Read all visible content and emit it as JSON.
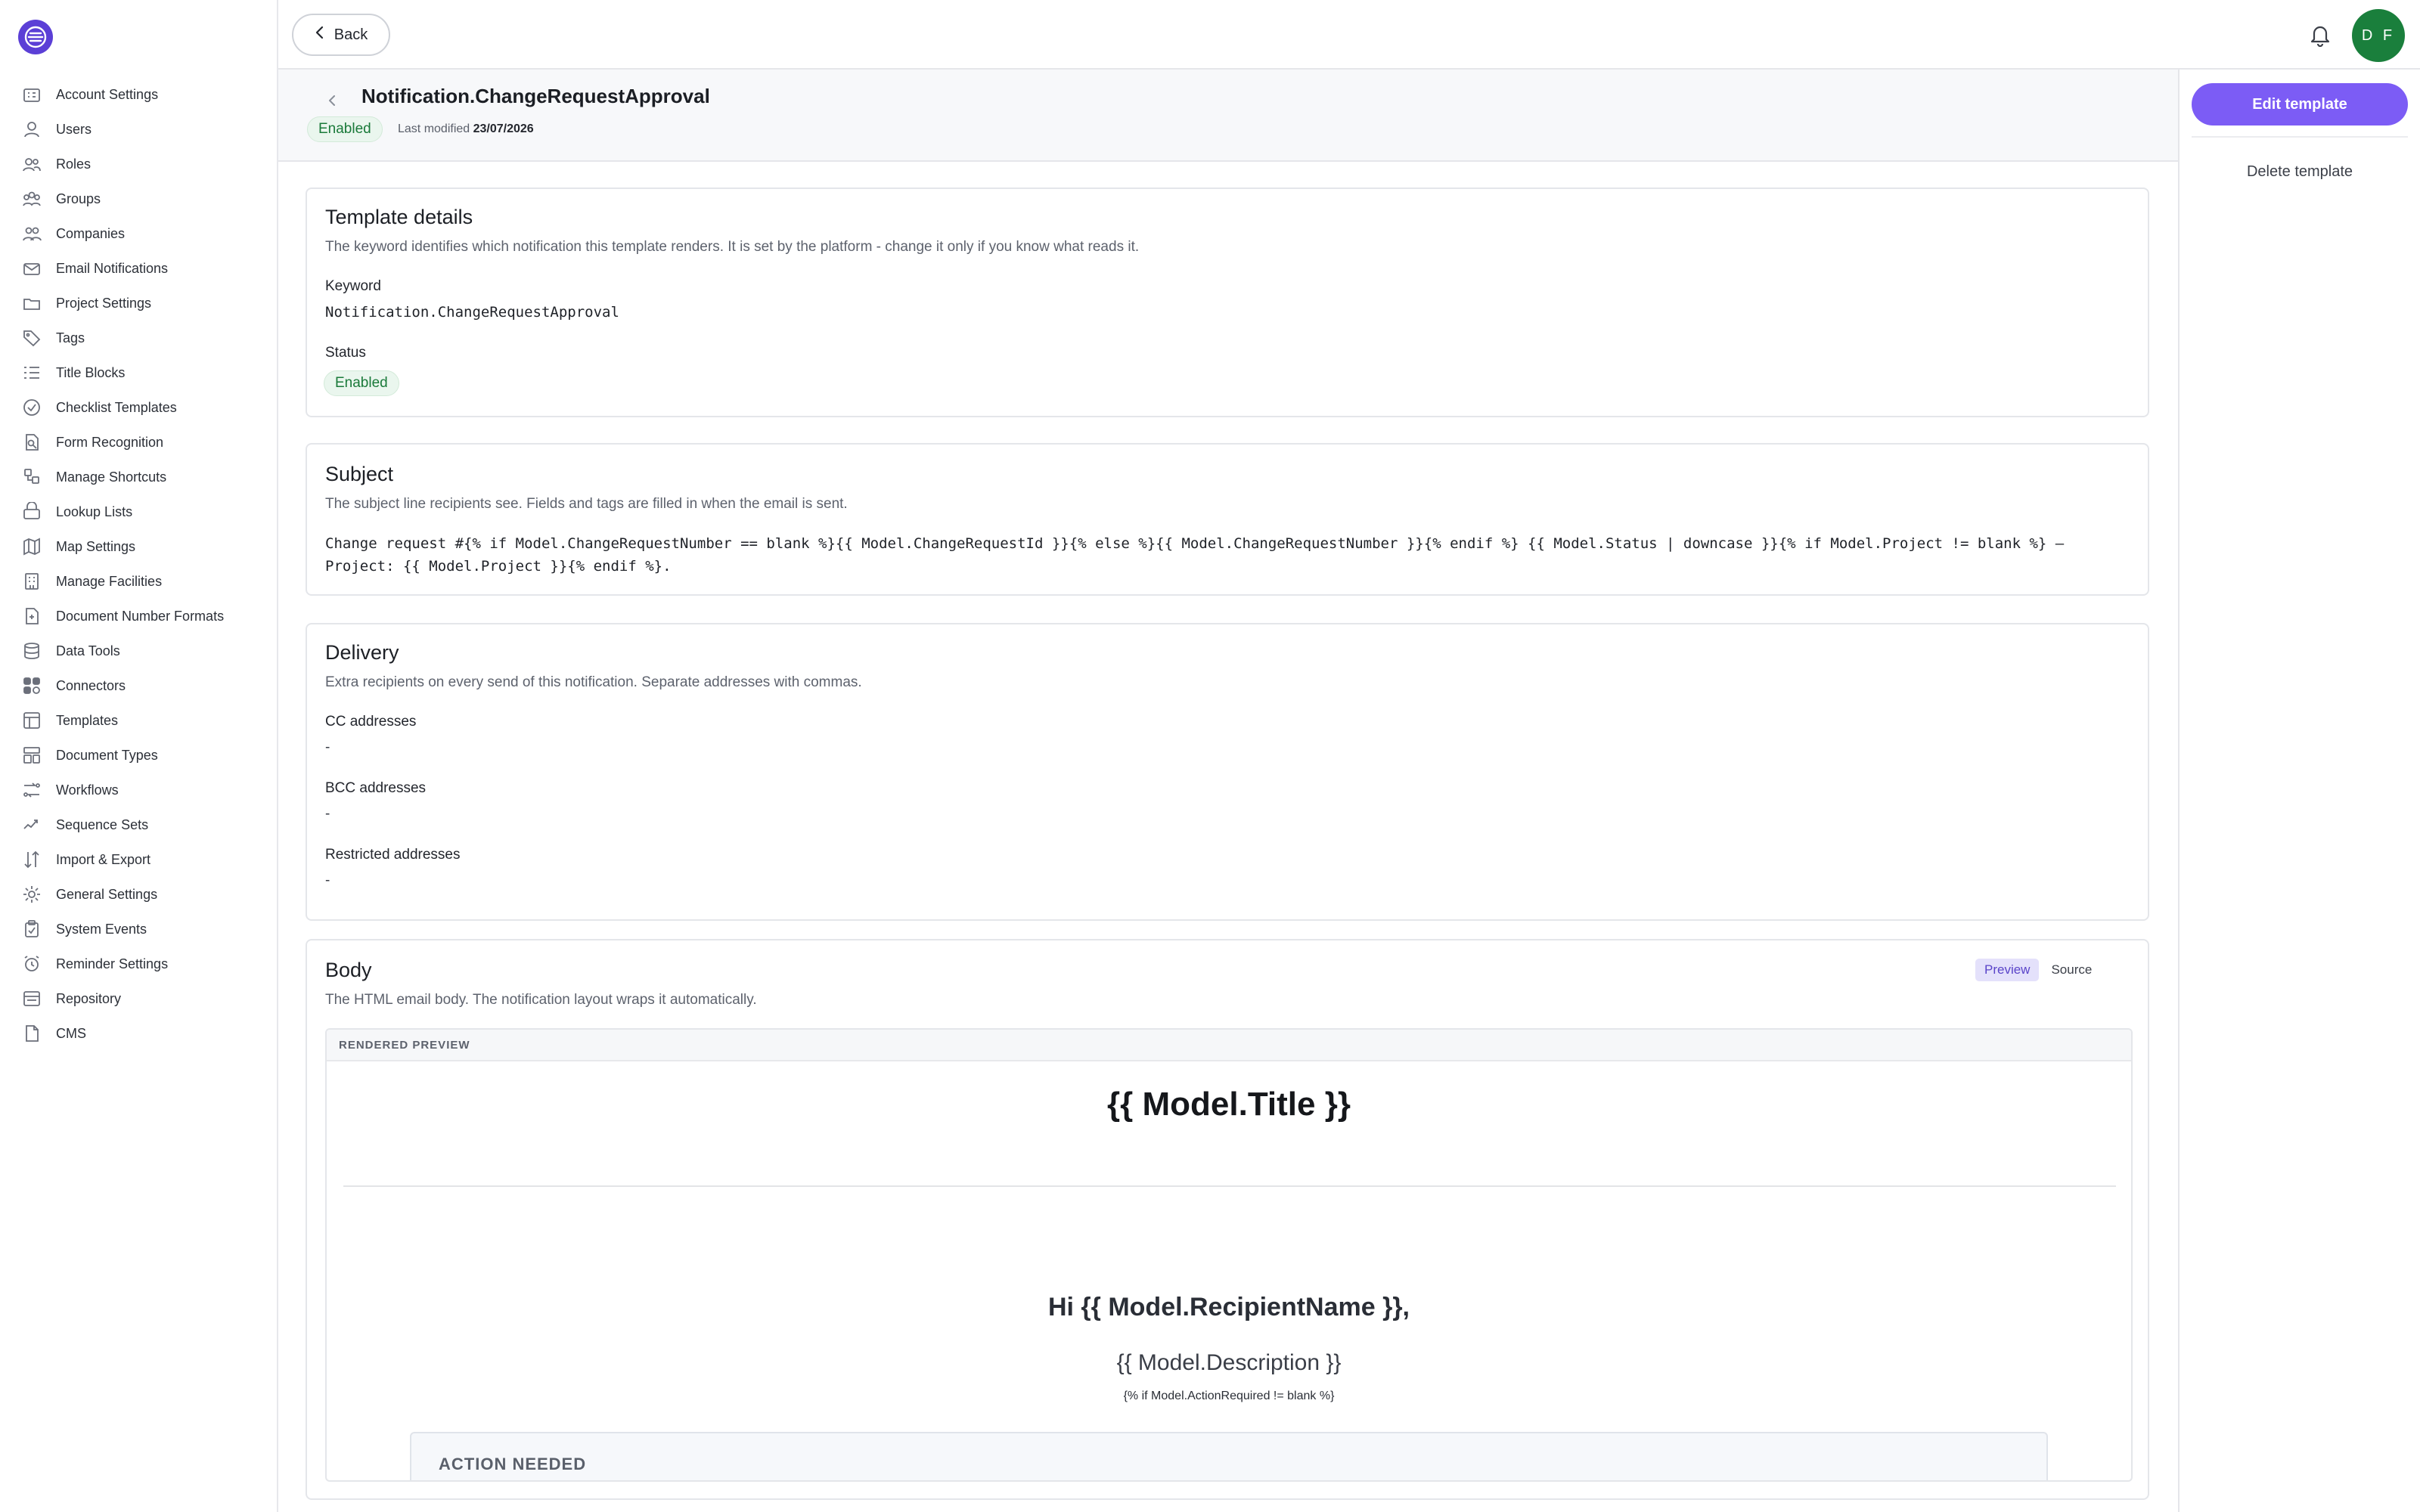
{
  "sidebar": {
    "items": [
      {
        "label": "Account Settings",
        "icon": "building-icon"
      },
      {
        "label": "Users",
        "icon": "user-icon"
      },
      {
        "label": "Roles",
        "icon": "roles-icon"
      },
      {
        "label": "Groups",
        "icon": "group-icon"
      },
      {
        "label": "Companies",
        "icon": "companies-icon"
      },
      {
        "label": "Email Notifications",
        "icon": "envelope-icon"
      },
      {
        "label": "Project Settings",
        "icon": "folder-icon"
      },
      {
        "label": "Tags",
        "icon": "tag-icon"
      },
      {
        "label": "Title Blocks",
        "icon": "list-icon"
      },
      {
        "label": "Checklist Templates",
        "icon": "check-circle-icon"
      },
      {
        "label": "Form Recognition",
        "icon": "form-scan-icon"
      },
      {
        "label": "Manage Shortcuts",
        "icon": "shortcut-icon"
      },
      {
        "label": "Lookup Lists",
        "icon": "lookup-icon"
      },
      {
        "label": "Map Settings",
        "icon": "map-icon"
      },
      {
        "label": "Manage Facilities",
        "icon": "facility-icon"
      },
      {
        "label": "Document Number Formats",
        "icon": "document-number-icon"
      },
      {
        "label": "Data Tools",
        "icon": "database-icon"
      },
      {
        "label": "Connectors",
        "icon": "connectors-icon"
      },
      {
        "label": "Templates",
        "icon": "template-icon"
      },
      {
        "label": "Document Types",
        "icon": "document-types-icon"
      },
      {
        "label": "Workflows",
        "icon": "workflow-icon"
      },
      {
        "label": "Sequence Sets",
        "icon": "sequence-icon"
      },
      {
        "label": "Import & Export",
        "icon": "import-export-icon"
      },
      {
        "label": "General Settings",
        "icon": "gear-icon"
      },
      {
        "label": "System Events",
        "icon": "clipboard-check-icon"
      },
      {
        "label": "Reminder Settings",
        "icon": "alarm-icon"
      },
      {
        "label": "Repository",
        "icon": "repository-icon"
      },
      {
        "label": "CMS",
        "icon": "file-icon"
      }
    ]
  },
  "topbar": {
    "back_label": "Back",
    "avatar_initials": "D F"
  },
  "header": {
    "title": "Notification.ChangeRequestApproval",
    "status_badge": "Enabled",
    "last_modified_label": "Last modified",
    "last_modified_value": "23/07/2026"
  },
  "actions": {
    "edit_label": "Edit template",
    "delete_label": "Delete template"
  },
  "template_details": {
    "title": "Template details",
    "description": "The keyword identifies which notification this template renders. It is set by the platform - change it only if you know what reads it.",
    "keyword_label": "Keyword",
    "keyword_value": "Notification.ChangeRequestApproval",
    "status_label": "Status",
    "status_value": "Enabled"
  },
  "subject": {
    "title": "Subject",
    "description": "The subject line recipients see. Fields and tags are filled in when the email is sent.",
    "code": "Change request #{% if Model.ChangeRequestNumber == blank %}{{ Model.ChangeRequestId }}{% else %}{{ Model.ChangeRequestNumber }}{% endif %} {{ Model.Status | downcase }}{% if Model.Project != blank %} – Project: {{ Model.Project }}{% endif %}."
  },
  "delivery": {
    "title": "Delivery",
    "description": "Extra recipients on every send of this notification. Separate addresses with commas.",
    "cc_label": "CC addresses",
    "cc_value": "-",
    "bcc_label": "BCC addresses",
    "bcc_value": "-",
    "restricted_label": "Restricted addresses",
    "restricted_value": "-"
  },
  "body": {
    "title": "Body",
    "description": "The HTML email body. The notification layout wraps it automatically.",
    "tabs": [
      "Preview",
      "Source"
    ],
    "active_tab": "Preview",
    "preview_header": "RENDERED PREVIEW",
    "preview": {
      "title": "{{ Model.Title }}",
      "greeting": "Hi {{ Model.RecipientName }},",
      "description": "{{ Model.Description }}",
      "condition": "{% if Model.ActionRequired != blank %}",
      "action_label": "ACTION NEEDED"
    }
  },
  "colors": {
    "accent": "#7c5cf5",
    "logo": "#5b3fd6",
    "avatar": "#1a7f3c",
    "enabled_badge_text": "#1a7a3a"
  }
}
